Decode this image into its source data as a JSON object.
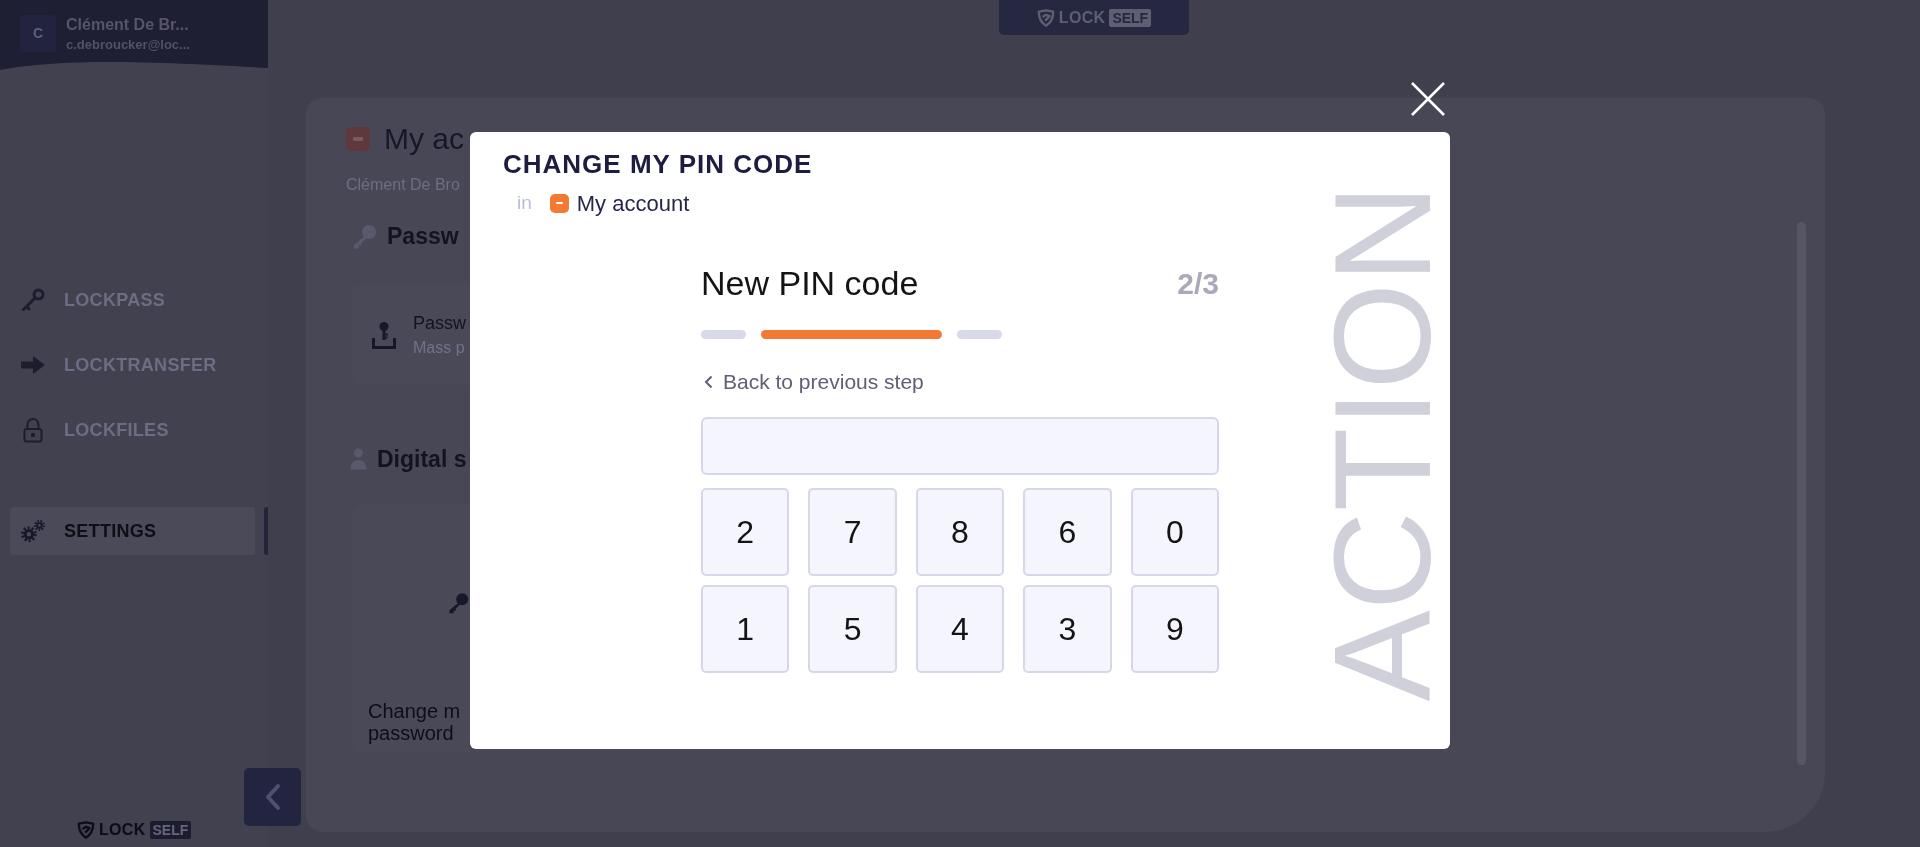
{
  "sidebar": {
    "user": {
      "initial": "C",
      "name": "Clément De Br...",
      "email": "c.debroucker@loc..."
    },
    "nav_groups": [
      {
        "items": [
          {
            "label": "LOCKPASS",
            "selected": false
          },
          {
            "label": "LOCKTRANSFER",
            "selected": false
          },
          {
            "label": "LOCKFILES",
            "selected": false
          }
        ]
      },
      {
        "items": [
          {
            "label": "SETTINGS",
            "selected": true
          }
        ]
      }
    ],
    "logo": {
      "wordmark": "LOCK",
      "tag": "SELF"
    }
  },
  "header_logo": {
    "wordmark": "LOCK",
    "tag": "SELF"
  },
  "page": {
    "title": "My ac",
    "subtitle": "Clément De Bro",
    "sections": [
      {
        "heading": "Passw",
        "card": {
          "kind": "list",
          "title": "Passw",
          "description": "Mass p"
        }
      },
      {
        "heading": "Digital s",
        "card": {
          "kind": "tile",
          "label_lines": [
            "Change m",
            "password"
          ]
        }
      }
    ]
  },
  "modal": {
    "title": "CHANGE MY PIN CODE",
    "location_prefix": "in",
    "location": "My account",
    "side_label": "ACTION",
    "step_title": "New PIN code",
    "step_counter": "2/3",
    "steps": [
      {
        "current": false
      },
      {
        "current": true
      },
      {
        "current": false
      }
    ],
    "back_link": "Back to previous step",
    "keypad": [
      "2",
      "7",
      "8",
      "6",
      "0",
      "1",
      "5",
      "4",
      "3",
      "9"
    ]
  }
}
